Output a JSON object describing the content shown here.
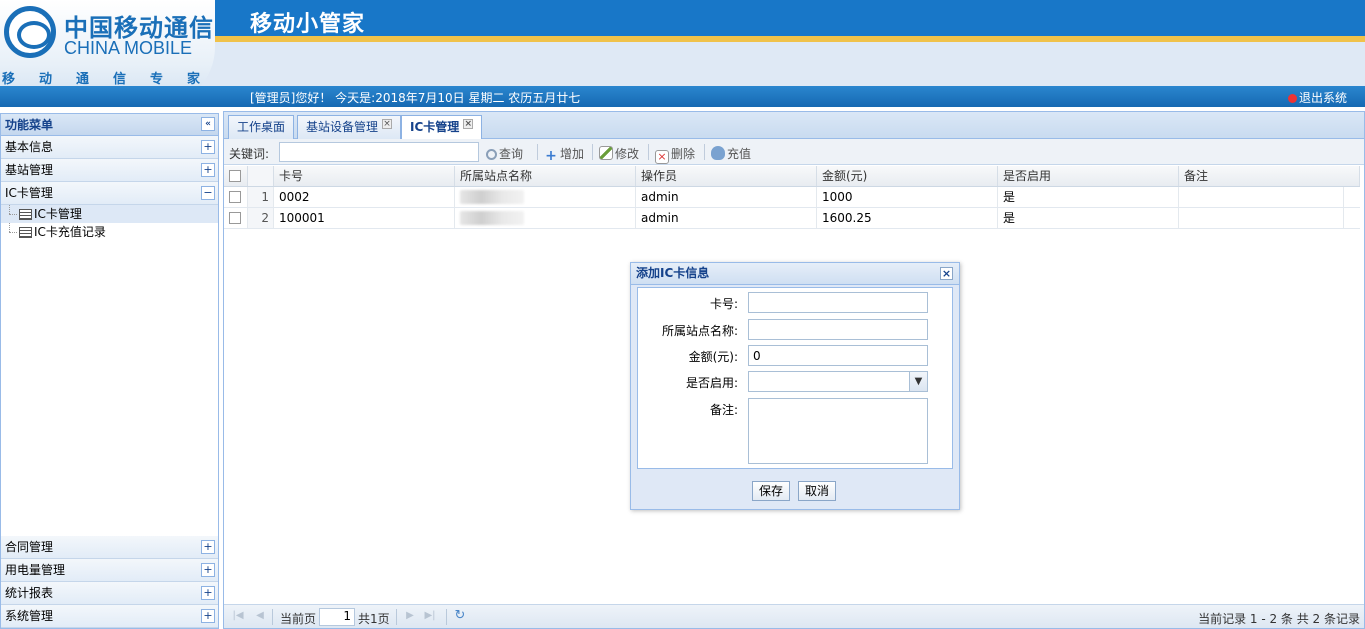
{
  "header": {
    "logo_cn": "中国移动通信",
    "logo_en": "CHINA MOBILE",
    "logo_sub": "移动通信专家",
    "app_title": "移动小管家",
    "greeting": "[管理员]您好！ 今天是:2018年7月10日 星期二 农历五月廿七",
    "logout_label": "退出系统"
  },
  "sidebar": {
    "title": "功能菜单",
    "top_items": [
      {
        "label": "基本信息",
        "toggle": "+"
      },
      {
        "label": "基站管理",
        "toggle": "+"
      },
      {
        "label": "IC卡管理",
        "toggle": "−"
      }
    ],
    "tree": [
      {
        "label": "IC卡管理",
        "selected": true
      },
      {
        "label": "IC卡充值记录",
        "selected": false
      }
    ],
    "bottom_items": [
      {
        "label": "合同管理",
        "toggle": "+"
      },
      {
        "label": "用电量管理",
        "toggle": "+"
      },
      {
        "label": "统计报表",
        "toggle": "+"
      },
      {
        "label": "系统管理",
        "toggle": "+"
      }
    ]
  },
  "tabs": [
    {
      "label": "工作桌面",
      "closable": false
    },
    {
      "label": "基站设备管理",
      "closable": true
    },
    {
      "label": "IC卡管理",
      "closable": true,
      "active": true
    }
  ],
  "toolbar": {
    "keyword_label": "关键词:",
    "buttons": [
      {
        "label": "查询",
        "icon": "search-icon"
      },
      {
        "label": "增加",
        "icon": "add-icon"
      },
      {
        "label": "修改",
        "icon": "edit-icon"
      },
      {
        "label": "删除",
        "icon": "delete-icon"
      },
      {
        "label": "充值",
        "icon": "money-bag-icon"
      }
    ]
  },
  "grid": {
    "columns": [
      "卡号",
      "所属站点名称",
      "操作员",
      "金额(元)",
      "是否启用",
      "备注"
    ],
    "rows": [
      {
        "num": "1",
        "card": "0002",
        "site": "",
        "operator": "admin",
        "amount": "1000",
        "enabled": "是",
        "note": ""
      },
      {
        "num": "2",
        "card": "100001",
        "site": "",
        "operator": "admin",
        "amount": "1600.25",
        "enabled": "是",
        "note": ""
      }
    ]
  },
  "pager": {
    "current_label": "当前页",
    "current_page": "1",
    "total_label": "共1页",
    "info": "当前记录 1 - 2 条 共 2 条记录"
  },
  "dialog": {
    "title": "添加IC卡信息",
    "fields": {
      "card_label": "卡号:",
      "card_value": "",
      "site_label": "所属站点名称:",
      "site_value": "",
      "amount_label": "金额(元):",
      "amount_value": "0",
      "enabled_label": "是否启用:",
      "enabled_value": "",
      "note_label": "备注:"
    },
    "save_label": "保存",
    "cancel_label": "取消"
  },
  "colors": {
    "header_blue": "#1877c8",
    "accent_gold": "#f0c24a",
    "panel_border": "#99bbe8",
    "title_text": "#15428b"
  }
}
